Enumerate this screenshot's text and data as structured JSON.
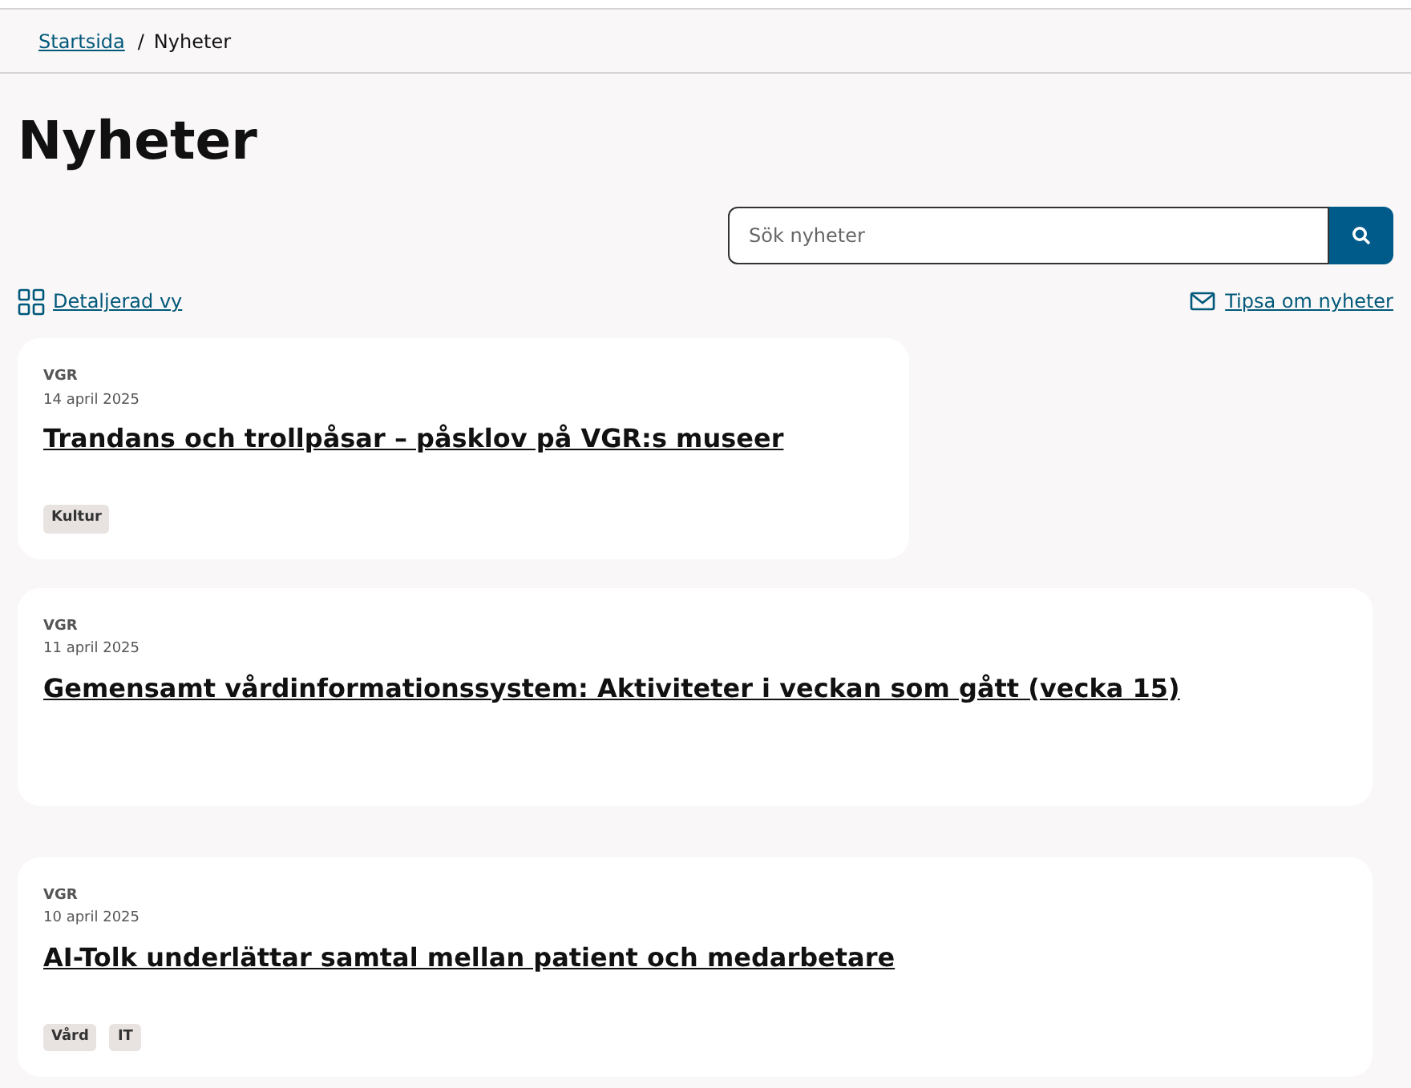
{
  "breadcrumb": [
    {
      "label": "Startsida",
      "link": true
    },
    {
      "label": "Nyheter",
      "link": false
    }
  ],
  "breadcrumb_separator": "/",
  "title": "Nyheter",
  "search": {
    "placeholder": "Sök nyheter"
  },
  "view_toggle": "Detaljerad vy",
  "tip_link": "Tipsa om nyheter",
  "articles": [
    {
      "source": "VGR",
      "date": "14 april 2025",
      "headline": "Trandans och trollpåsar – påsklov på VGR:s museer",
      "wide": false,
      "tags": [
        "Kultur"
      ]
    },
    {
      "source": "VGR",
      "date": "11 april 2025",
      "headline": "Gemensamt vårdinformationssystem: Aktiviteter i veckan som gått (vecka 15)",
      "wide": true
    },
    {
      "source": "VGR",
      "date": "10 april 2025",
      "headline": "AI-Tolk underlättar samtal mellan patient och medarbetare",
      "wide": true,
      "tags": [
        "Vård",
        "IT"
      ]
    }
  ]
}
